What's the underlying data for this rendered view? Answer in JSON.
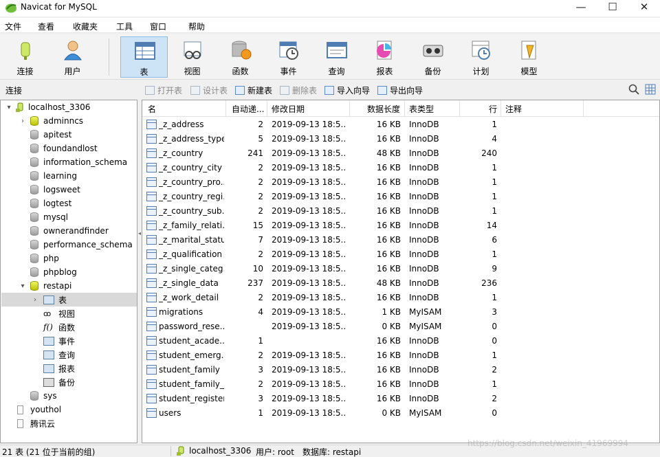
{
  "window": {
    "title": "Navicat for MySQL",
    "controls": [
      "—",
      "☐",
      "✕"
    ]
  },
  "menu": [
    "文件",
    "查看",
    "收藏夹",
    "工具",
    "窗口",
    "帮助"
  ],
  "toolbar": {
    "buttons": [
      {
        "label": "连接",
        "icon": "connection-icon"
      },
      {
        "label": "用户",
        "icon": "user-icon"
      },
      {
        "label": "表",
        "icon": "table-icon",
        "active": true
      },
      {
        "label": "视图",
        "icon": "view-icon"
      },
      {
        "label": "函数",
        "icon": "function-icon"
      },
      {
        "label": "事件",
        "icon": "event-icon"
      },
      {
        "label": "查询",
        "icon": "query-icon"
      },
      {
        "label": "报表",
        "icon": "report-icon"
      },
      {
        "label": "备份",
        "icon": "backup-icon"
      },
      {
        "label": "计划",
        "icon": "schedule-icon"
      },
      {
        "label": "模型",
        "icon": "model-icon"
      }
    ]
  },
  "actionbar": {
    "connection_label": "连接",
    "actions": [
      {
        "label": "打开表",
        "enabled": false
      },
      {
        "label": "设计表",
        "enabled": false
      },
      {
        "label": "新建表",
        "enabled": true
      },
      {
        "label": "删除表",
        "enabled": false
      },
      {
        "label": "导入向导",
        "enabled": true
      },
      {
        "label": "导出向导",
        "enabled": true
      }
    ]
  },
  "tree": {
    "connection": "localhost_3306",
    "databases": [
      "adminncs",
      "apitest",
      "foundandlost",
      "information_schema",
      "learning",
      "logsweet",
      "logtest",
      "mysql",
      "ownerandfinder",
      "performance_schema",
      "php",
      "phpblog",
      "restapi"
    ],
    "open_database": "restapi",
    "restapi_children": [
      "表",
      "视图",
      "函数",
      "事件",
      "查询",
      "报表",
      "备份"
    ],
    "after": [
      "sys"
    ],
    "other_connections": [
      "youthol",
      "腾讯云"
    ]
  },
  "table": {
    "columns": [
      "名",
      "自动递...",
      "修改日期",
      "数据长度",
      "表类型",
      "行",
      "注释"
    ],
    "rows": [
      {
        "name": "_z_address",
        "auto": "2",
        "date": "2019-09-13 18:5...",
        "size": "16 KB",
        "engine": "InnoDB",
        "rows": "1"
      },
      {
        "name": "_z_address_type",
        "auto": "5",
        "date": "2019-09-13 18:5...",
        "size": "16 KB",
        "engine": "InnoDB",
        "rows": "4"
      },
      {
        "name": "_z_country",
        "auto": "241",
        "date": "2019-09-13 18:5...",
        "size": "48 KB",
        "engine": "InnoDB",
        "rows": "240"
      },
      {
        "name": "_z_country_city",
        "auto": "2",
        "date": "2019-09-13 18:5...",
        "size": "16 KB",
        "engine": "InnoDB",
        "rows": "1"
      },
      {
        "name": "_z_country_pro...",
        "auto": "2",
        "date": "2019-09-13 18:5...",
        "size": "16 KB",
        "engine": "InnoDB",
        "rows": "1"
      },
      {
        "name": "_z_country_regi...",
        "auto": "2",
        "date": "2019-09-13 18:5...",
        "size": "16 KB",
        "engine": "InnoDB",
        "rows": "1"
      },
      {
        "name": "_z_country_sub...",
        "auto": "2",
        "date": "2019-09-13 18:5...",
        "size": "16 KB",
        "engine": "InnoDB",
        "rows": "1"
      },
      {
        "name": "_z_family_relati...",
        "auto": "15",
        "date": "2019-09-13 18:5...",
        "size": "16 KB",
        "engine": "InnoDB",
        "rows": "14"
      },
      {
        "name": "_z_marital_status",
        "auto": "7",
        "date": "2019-09-13 18:5...",
        "size": "16 KB",
        "engine": "InnoDB",
        "rows": "6"
      },
      {
        "name": "_z_qualification",
        "auto": "2",
        "date": "2019-09-13 18:5...",
        "size": "16 KB",
        "engine": "InnoDB",
        "rows": "1"
      },
      {
        "name": "_z_single_categ...",
        "auto": "10",
        "date": "2019-09-13 18:5...",
        "size": "16 KB",
        "engine": "InnoDB",
        "rows": "9"
      },
      {
        "name": "_z_single_data",
        "auto": "237",
        "date": "2019-09-13 18:5...",
        "size": "48 KB",
        "engine": "InnoDB",
        "rows": "236"
      },
      {
        "name": "_z_work_detail",
        "auto": "2",
        "date": "2019-09-13 18:5...",
        "size": "16 KB",
        "engine": "InnoDB",
        "rows": "1"
      },
      {
        "name": "migrations",
        "auto": "4",
        "date": "2019-09-13 18:5...",
        "size": "1 KB",
        "engine": "MyISAM",
        "rows": "3"
      },
      {
        "name": "password_rese...",
        "auto": "",
        "date": "2019-09-13 18:5...",
        "size": "0 KB",
        "engine": "MyISAM",
        "rows": "0"
      },
      {
        "name": "student_acade...",
        "auto": "1",
        "date": "",
        "size": "16 KB",
        "engine": "InnoDB",
        "rows": "0"
      },
      {
        "name": "student_emerg...",
        "auto": "2",
        "date": "2019-09-13 18:5...",
        "size": "16 KB",
        "engine": "InnoDB",
        "rows": "1"
      },
      {
        "name": "student_family",
        "auto": "3",
        "date": "2019-09-13 18:5...",
        "size": "16 KB",
        "engine": "InnoDB",
        "rows": "2"
      },
      {
        "name": "student_family_...",
        "auto": "2",
        "date": "2019-09-13 18:5...",
        "size": "16 KB",
        "engine": "InnoDB",
        "rows": "1"
      },
      {
        "name": "student_register",
        "auto": "3",
        "date": "2019-09-13 18:5...",
        "size": "16 KB",
        "engine": "InnoDB",
        "rows": "2"
      },
      {
        "name": "users",
        "auto": "1",
        "date": "2019-09-13 18:5...",
        "size": "0 KB",
        "engine": "MyISAM",
        "rows": "0"
      }
    ]
  },
  "status": {
    "count": "21 表 (21 位于当前的组)",
    "connection": "localhost_3306",
    "user": "用户: root",
    "database": "数据库: restapi"
  },
  "watermark": "https://blog.csdn.net/weixin_41969994",
  "colors": {
    "active_tool": "#cde4f7",
    "selected_node": "#d9d9d9",
    "open_db": "#c8d400"
  }
}
